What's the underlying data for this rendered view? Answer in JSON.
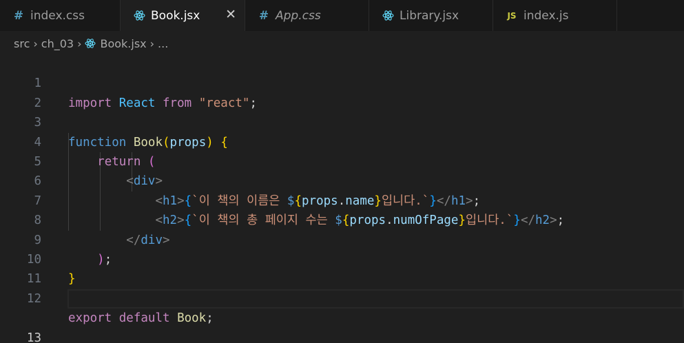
{
  "tabs": [
    {
      "label": "index.css",
      "icon": "#",
      "italic": false
    },
    {
      "label": "Book.jsx",
      "icon": "react",
      "italic": false,
      "active": true
    },
    {
      "label": "App.css",
      "icon": "#",
      "italic": true
    },
    {
      "label": "Library.jsx",
      "icon": "react",
      "italic": false
    },
    {
      "label": "index.js",
      "icon": "JS",
      "italic": false
    }
  ],
  "breadcrumb": [
    "src",
    "ch_03",
    "Book.jsx",
    "..."
  ],
  "line_numbers": [
    "1",
    "2",
    "3",
    "4",
    "5",
    "6",
    "7",
    "8",
    "9",
    "10",
    "11",
    "12",
    "13"
  ],
  "code": {
    "l1": {
      "k1": "import",
      "i1": "React",
      "k2": "from",
      "s1": "\"react\"",
      "p": ";"
    },
    "l3": {
      "k1": "function",
      "f1": "Book",
      "o": "(",
      "a": "props",
      "c": ")",
      "b": "{"
    },
    "l4": {
      "k1": "return",
      "o": "("
    },
    "l5": {
      "lt": "<",
      "t": "div",
      "gt": ">"
    },
    "l6": {
      "lt": "<",
      "t": "h1",
      "gt": ">",
      "bo": "{",
      "bt": "`",
      "txt": "이 책의 이름은 ",
      "d": "$",
      "io": "{",
      "obj": "props",
      "dot": ".",
      "prop": "name",
      "ic": "}",
      "txt2": "입니다.",
      "bt2": "`",
      "bc": "}",
      "clt": "</",
      "ct": "h1",
      "cgt": ">",
      "semi": ";"
    },
    "l7": {
      "lt": "<",
      "t": "h2",
      "gt": ">",
      "bo": "{",
      "bt": "`",
      "txt": "이 책의 총 페이지 수는 ",
      "d": "$",
      "io": "{",
      "obj": "props",
      "dot": ".",
      "prop": "numOfPage",
      "ic": "}",
      "txt2": "입니다.",
      "bt2": "`",
      "bc": "}",
      "clt": "</",
      "ct": "h2",
      "cgt": ">",
      "semi": ";"
    },
    "l8": {
      "lt": "</",
      "t": "div",
      "gt": ">"
    },
    "l9": {
      "c": ")",
      "semi": ";"
    },
    "l10": {
      "b": "}"
    },
    "l12": {
      "k1": "export",
      "k2": "default",
      "f1": "Book",
      "semi": ";"
    }
  },
  "colors": {
    "background": "#1f1f1f",
    "tabbar": "#181818",
    "keyword": "#c586c0",
    "string": "#ce9178",
    "identifier": "#9cdcfe"
  }
}
